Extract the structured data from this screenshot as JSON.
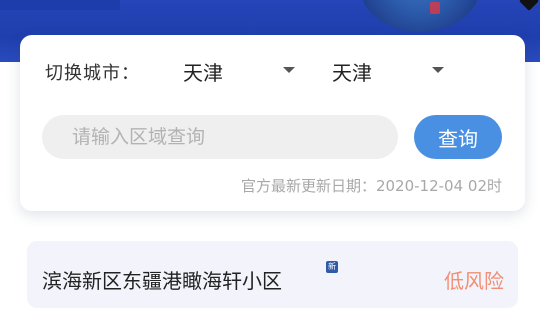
{
  "filter": {
    "label": "切换城市：",
    "province_value": "天津",
    "city_value": "天津"
  },
  "search": {
    "placeholder": "请输入区域查询",
    "button_label": "查询"
  },
  "update": {
    "text": "官方最新更新日期：2020-12-04 02时"
  },
  "results": [
    {
      "name": "滨海新区东疆港瞰海轩小区",
      "badge": "新",
      "risk": "低风险"
    }
  ],
  "colors": {
    "banner": "#1f3fae",
    "accent": "#4a90e2",
    "low_risk": "#f08f76"
  },
  "icons": {
    "select_caret": "chevron-down-icon",
    "new_badge": "new-badge-icon"
  }
}
